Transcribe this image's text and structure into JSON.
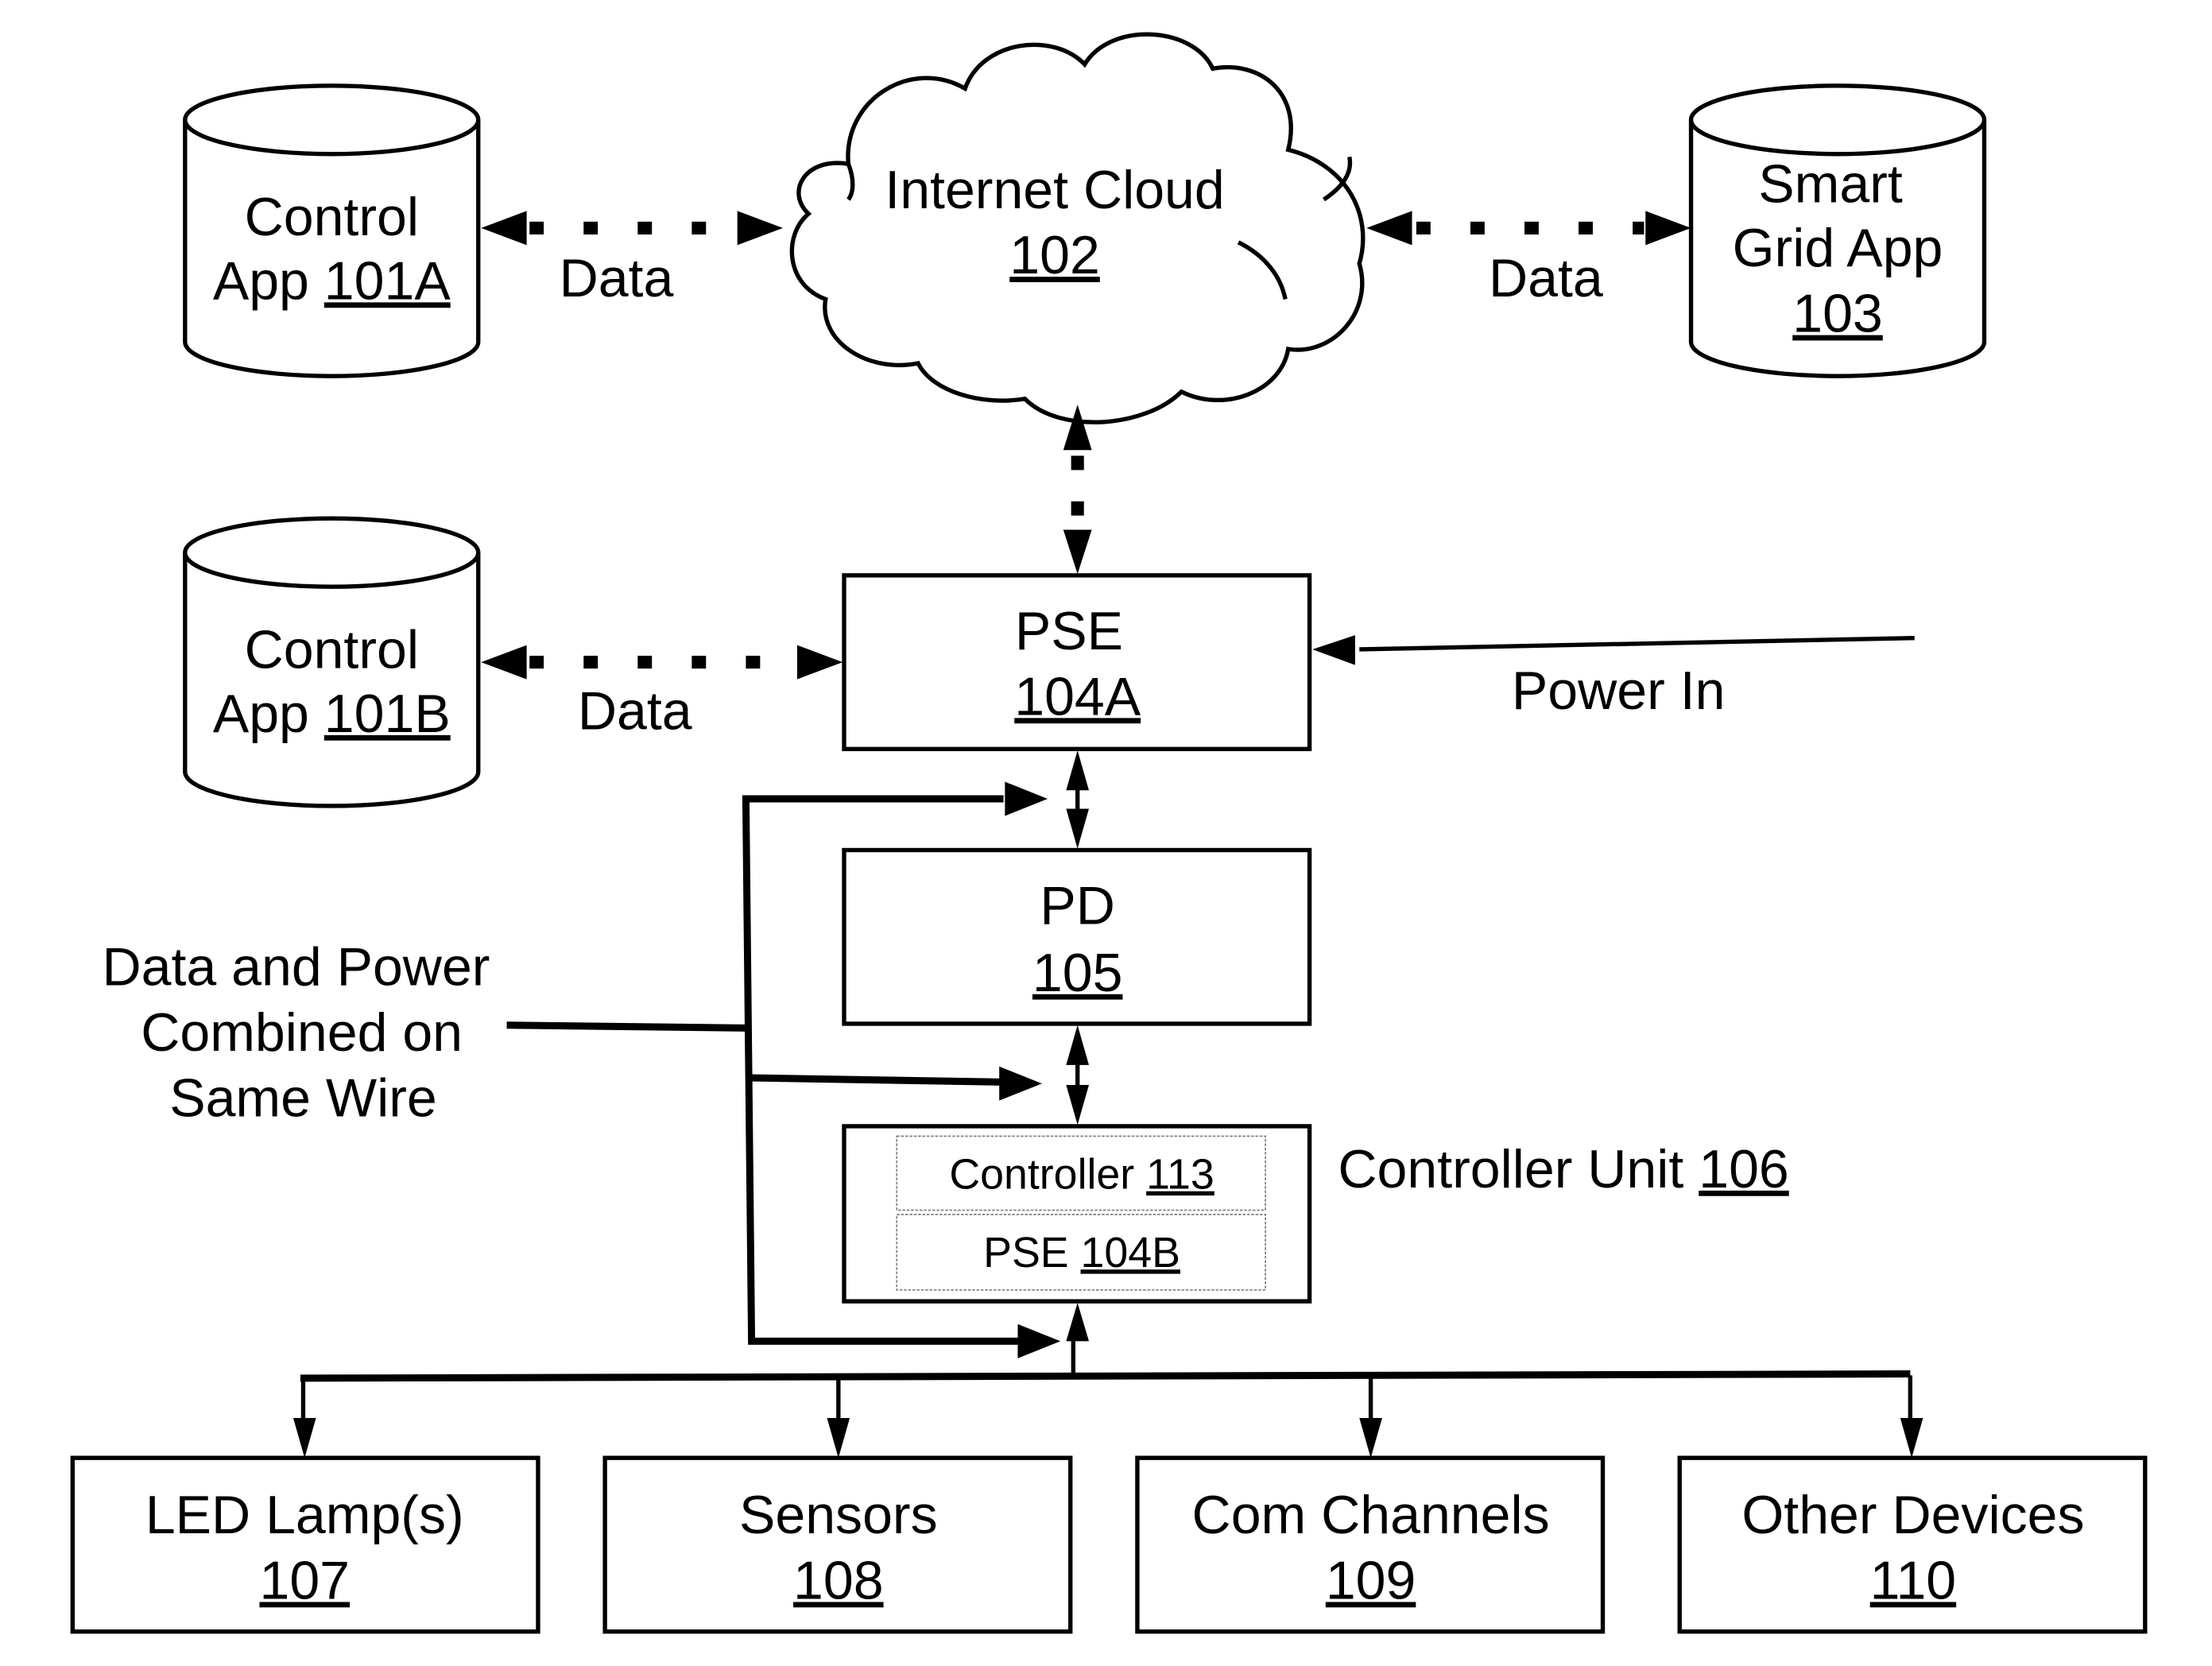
{
  "diagram": {
    "control_app_a": {
      "line1": "Control",
      "line2_prefix": "App ",
      "ref": "101A"
    },
    "control_app_b": {
      "line1": "Control",
      "line2_prefix": "App ",
      "ref": "101B"
    },
    "internet_cloud": {
      "label": "Internet Cloud",
      "ref": "102"
    },
    "smart_grid_app": {
      "line1": "Smart",
      "line2": "Grid App",
      "ref": "103"
    },
    "pse_a": {
      "label": "PSE",
      "ref": "104A"
    },
    "pd": {
      "label": "PD",
      "ref": "105"
    },
    "controller_unit": {
      "label_prefix": "Controller Unit ",
      "ref": "106",
      "controller": {
        "label_prefix": "Controller ",
        "ref": "113"
      },
      "pse_b": {
        "label_prefix": "PSE ",
        "ref": "104B"
      }
    },
    "devices": [
      {
        "label": "LED Lamp(s)",
        "ref": "107"
      },
      {
        "label": "Sensors",
        "ref": "108"
      },
      {
        "label": "Com Channels",
        "ref": "109"
      },
      {
        "label": "Other Devices",
        "ref": "110"
      }
    ],
    "edge_labels": {
      "data_a": "Data",
      "data_b": "Data",
      "data_smart": "Data",
      "power_in": "Power In",
      "combined": [
        "Data and Power",
        "Combined on",
        "Same Wire"
      ]
    }
  }
}
